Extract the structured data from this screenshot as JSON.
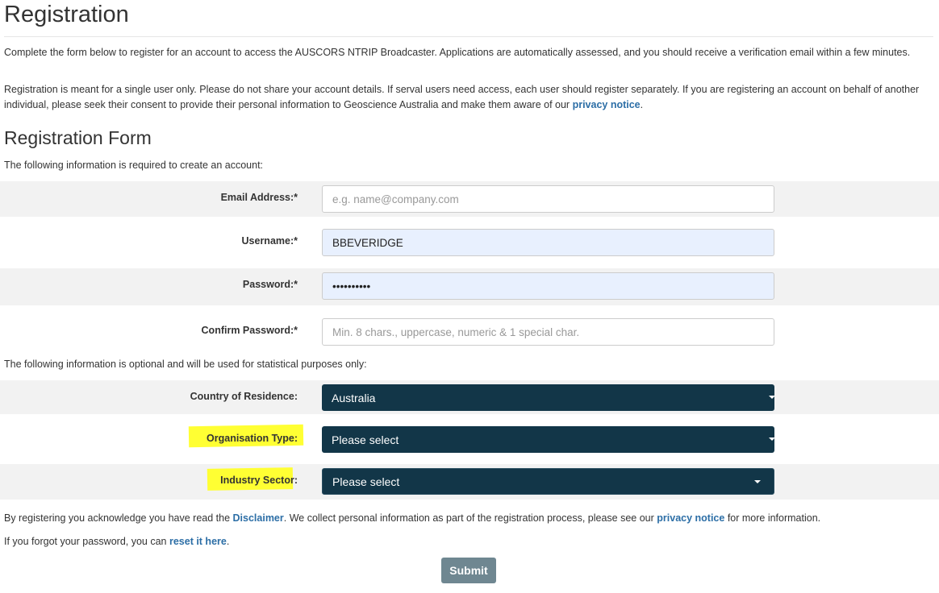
{
  "page": {
    "title": "Registration",
    "intro1": "Complete the form below to register for an account to access the AUSCORS NTRIP Broadcaster. Applications are automatically assessed, and you should receive a verification email within a few minutes.",
    "intro2_pre": "Registration is meant for a single user only. Please do not share your account details. If serval users need access, each user should register separately. If you are registering an account on behalf of another individual, please seek their consent to provide their personal information to Geoscience Australia and make them aware of our ",
    "intro2_link": "privacy notice",
    "intro2_post": "."
  },
  "form": {
    "heading": "Registration Form",
    "required_note": "The following information is required to create an account:",
    "email": {
      "label": "Email Address:*",
      "placeholder": "e.g. name@company.com",
      "value": ""
    },
    "username": {
      "label": "Username:*",
      "value": "BBEVERIDGE"
    },
    "password": {
      "label": "Password:*",
      "value": "••••••••••"
    },
    "confirm": {
      "label": "Confirm Password:*",
      "placeholder": "Min. 8 chars., uppercase, numeric & 1 special char.",
      "value": ""
    },
    "optional_note": "The following information is optional and will be used for statistical purposes only:",
    "country": {
      "label": "Country of Residence:",
      "selected": "Australia"
    },
    "org_type": {
      "label": "Organisation Type:",
      "selected": "Please select"
    },
    "industry": {
      "label": "Industry Sector:",
      "selected": "Please select"
    },
    "highlight_color": "#ffff33",
    "select_bg": "#123648"
  },
  "footer": {
    "ack_pre": "By registering you acknowledge you have read the ",
    "ack_link1": "Disclaimer",
    "ack_mid": ". We collect personal information as part of the registration process, please see our ",
    "ack_link2": "privacy notice",
    "ack_post": " for more information.",
    "forgot_pre": "If you forgot your password, you can ",
    "forgot_link": "reset it here",
    "forgot_post": ".",
    "submit_label": "Submit"
  }
}
